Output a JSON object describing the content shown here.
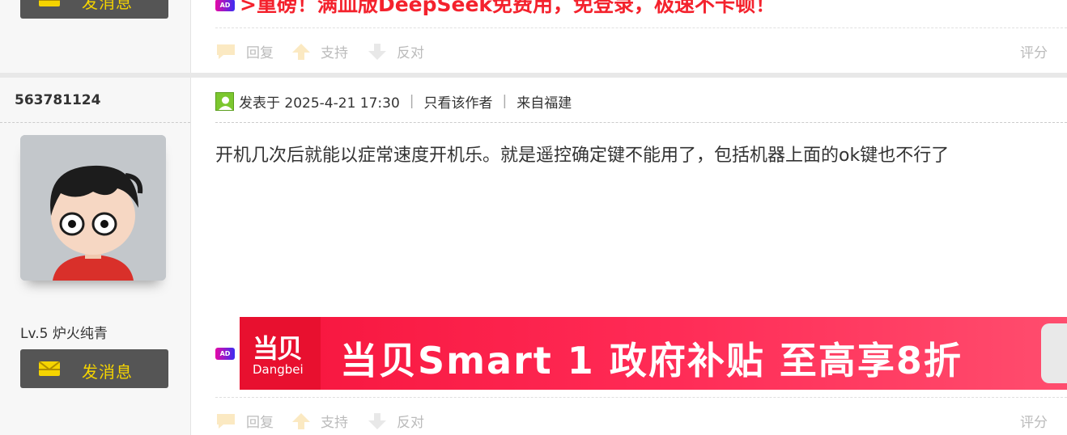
{
  "prev_post": {
    "send_message_label": "发消息",
    "ad_badge": "AD",
    "ad_text": ">重磅！满血版DeepSeek免费用，免登录，极速不卡顿！",
    "actions": {
      "reply": "回复",
      "support": "支持",
      "oppose": "反对",
      "rate": "评分"
    }
  },
  "post": {
    "username": "563781124",
    "level": "Lv.5 炉火纯青",
    "send_message_label": "发消息",
    "meta": {
      "posted_at": "发表于 2025-4-21 17:30",
      "sep": "|",
      "only_author": "只看该作者",
      "location": "来自福建"
    },
    "content": "开机几次后就能以症常速度开机乐。就是遥控确定键不能用了，包括机器上面的ok键也不行了",
    "ad": {
      "badge": "AD",
      "brand_cn": "当贝",
      "brand_en": "Dangbei",
      "slogan": "当贝Smart 1  政府补贴 至高享8折"
    },
    "actions": {
      "reply": "回复",
      "support": "支持",
      "oppose": "反对",
      "rate": "评分"
    }
  },
  "colors": {
    "accent_red": "#f4222d",
    "button_bg": "#555555",
    "button_text": "#f5d400",
    "banner_red": "#f6143c"
  }
}
